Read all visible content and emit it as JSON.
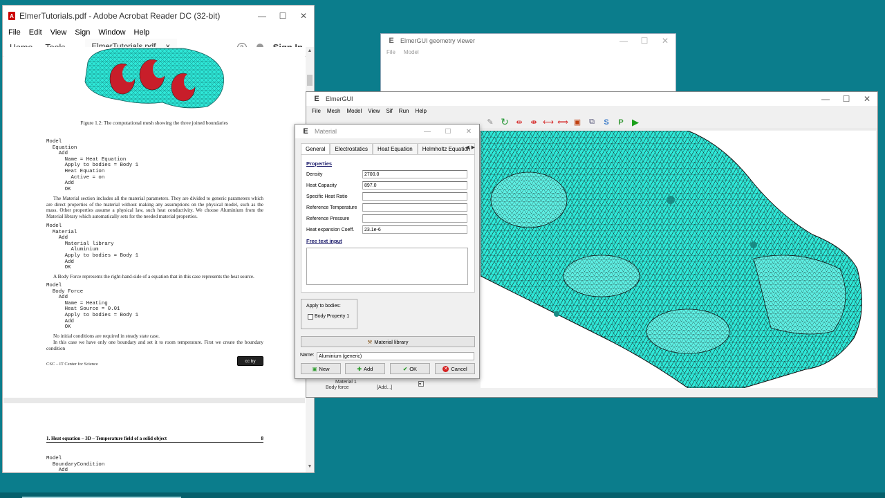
{
  "acrobat": {
    "title": "ElmerTutorials.pdf - Adobe Acrobat Reader DC (32-bit)",
    "menu": [
      "File",
      "Edit",
      "View",
      "Sign",
      "Window",
      "Help"
    ],
    "nav_home": "Home",
    "nav_tools": "Tools",
    "tab_label": "ElmerTutorials.pdf",
    "tab_close": "×",
    "help_glyph": "?",
    "sign_in": "Sign In",
    "page1": {
      "caption": "Figure 1.2: The computational mesh showing the three joined boundaries",
      "code1": "Model\n  Equation\n    Add\n      Name = Heat Equation\n      Apply to bodies = Body 1\n      Heat Equation\n        Active = on\n      Add\n      OK",
      "para1": "The Material section includes all the material parameters. They are divided to generic parameters which are direct properties of the material without making any assumptions on the physical model, such as the mass. Other properties assume a physical law, such heat conductivity. We choose Aluminium from the Material library which automatically sets for the needed material properties.",
      "code2": "Model\n  Material\n    Add\n      Material library\n        Aluminium\n      Apply to bodies = Body 1\n      Add\n      OK",
      "para2": "A Body Force represents the right-hand-side of a equation that in this case represents the heat source.",
      "code3": "Model\n  Body Force\n    Add\n      Name = Heating\n      Heat Source = 0.01\n      Apply to bodies = Body 1\n      Add\n      OK",
      "para3": "No initial conditions are required in steady state case.",
      "para4": "In this case we have only one boundary and set it to room temperature.  First we create the boundary condition",
      "footer": "CSC – IT Center for Science",
      "cc_badge": "cc by"
    },
    "page2": {
      "header_left": "1. Heat equation – 3D – Temperature field of a solid object",
      "header_right": "8",
      "code": "Model\n  BoundaryCondition\n    Add\n      Heat Equation"
    }
  },
  "geometry_viewer": {
    "title": "ElmerGUI geometry viewer",
    "menu": [
      "File",
      "Model"
    ]
  },
  "elmergui": {
    "title": "ElmerGUI",
    "title_icon": "E",
    "menu": [
      "File",
      "Mesh",
      "Model",
      "View",
      "Sif",
      "Run",
      "Help"
    ],
    "tree_item_1": "Material 1",
    "tree_item_2": "Body force",
    "tree_item_2_value": "[Add...]"
  },
  "material_dialog": {
    "title": "Material",
    "title_icon": "E",
    "tabs": [
      "General",
      "Electrostatics",
      "Heat Equation",
      "Helmholtz Equation"
    ],
    "properties_header": "Properties",
    "properties": [
      {
        "label": "Density",
        "value": "2700.0"
      },
      {
        "label": "Heat Capacity",
        "value": "897.0"
      },
      {
        "label": "Specific Heat Ratio",
        "value": ""
      },
      {
        "label": "Reference Temperature",
        "value": ""
      },
      {
        "label": "Reference Pressure",
        "value": ""
      },
      {
        "label": "Heat expansion Coeff.",
        "value": "23.1e-6"
      }
    ],
    "free_text_header": "Free text input",
    "apply_to_bodies": "Apply to bodies:",
    "body_property": "Body Property 1",
    "material_library_button": "Material library",
    "name_label": "Name:",
    "name_value": "Aluminium (generic)",
    "buttons": {
      "new": "New",
      "add": "Add",
      "ok": "OK",
      "cancel": "Cancel"
    }
  },
  "colors": {
    "desktop": "#0b7d8c",
    "mesh_fill": "#2ee8d8",
    "mesh_edges": "#1a1a1a",
    "boundary_red": "#c81e2a",
    "ok_green": "#2a9a2a",
    "cancel_red": "#d42020"
  }
}
